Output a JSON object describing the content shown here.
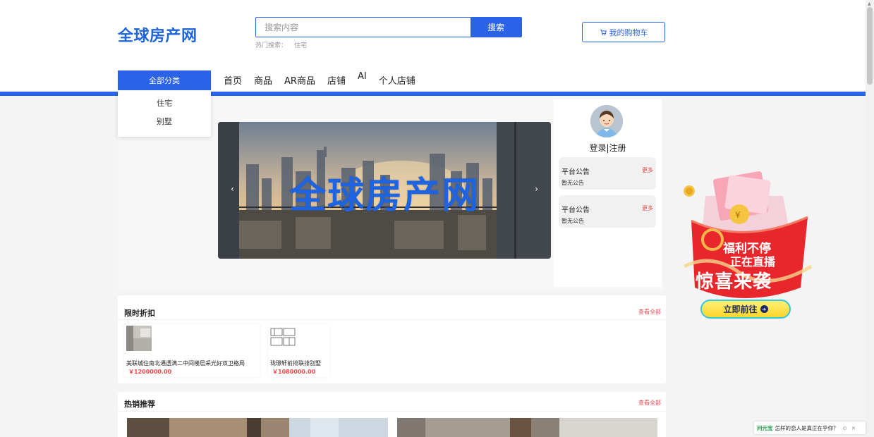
{
  "header": {
    "logo": "全球房产网",
    "search_placeholder": "搜索内容",
    "search_button": "搜索",
    "hot_label": "热门搜索：",
    "hot_term": "住宅",
    "cart_label": "我的购物车"
  },
  "nav": {
    "category_button": "全部分类",
    "items": [
      "首页",
      "商品",
      "AR商品",
      "店铺",
      "AI",
      "个人店铺"
    ],
    "dropdown": [
      "住宅",
      "别墅"
    ]
  },
  "banner": {
    "title": "全球房产网",
    "prev_icon": "chevron-left-icon",
    "next_icon": "chevron-right-icon"
  },
  "user_panel": {
    "login_text": "登录|注册",
    "notices": [
      {
        "title": "平台公告",
        "more": "更多",
        "empty": "暂无公告"
      },
      {
        "title": "平台公告",
        "more": "更多",
        "empty": "暂无公告"
      }
    ]
  },
  "flash_sale": {
    "title": "限时折扣",
    "more": "查看全部",
    "products": [
      {
        "name": "美联城住南北通透满二中间楼层采光好双卫格局",
        "price": "￥1200000.00"
      },
      {
        "name": "珑璟轩前排联排别墅",
        "price": "￥1080000.00"
      }
    ]
  },
  "hot": {
    "title": "热销推荐",
    "more": "查看全部"
  },
  "promo": {
    "line1": "福利不停",
    "line2": "正在直播",
    "line3": "惊喜来袭",
    "button": "立即前往"
  },
  "ask_bar": {
    "brand": "问元宝",
    "message": "怎样的恋人是真正在乎你？"
  },
  "colors": {
    "primary": "#2a63e8",
    "price_red": "#e84a4a"
  }
}
